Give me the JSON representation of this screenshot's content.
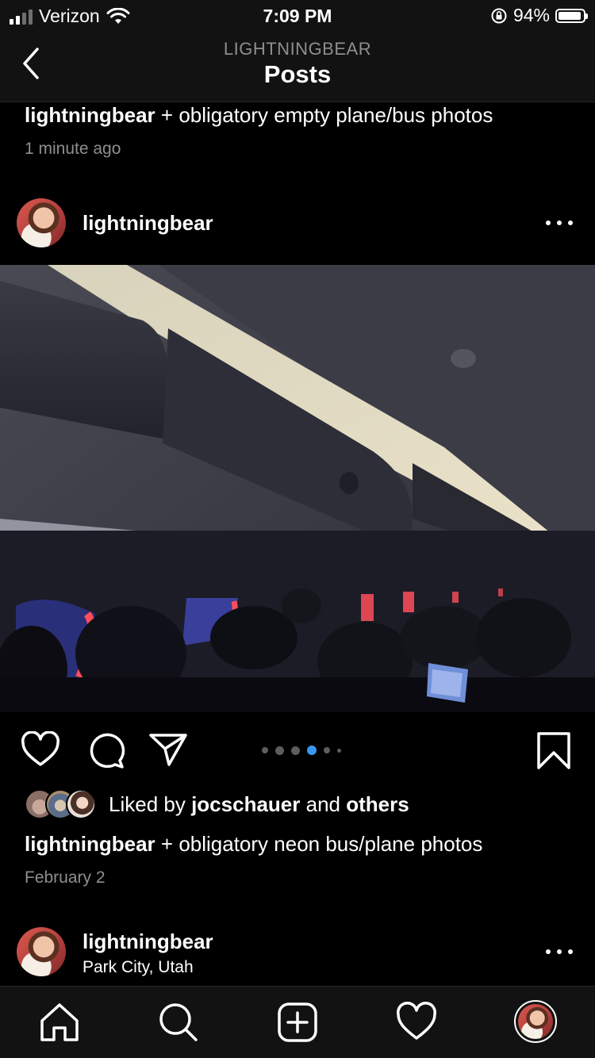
{
  "status_bar": {
    "carrier": "Verizon",
    "time": "7:09 PM",
    "battery": "94%",
    "battery_level": 0.94
  },
  "header": {
    "subtitle": "LIGHTNINGBEAR",
    "title": "Posts"
  },
  "prev_post": {
    "username": "lightningbear",
    "caption": "+ obligatory empty plane/bus photos",
    "time": "1 minute ago"
  },
  "post": {
    "username": "lightningbear",
    "photo_icon": "airplane-cabin-photo",
    "carousel_total": 6,
    "carousel_active_index": 3,
    "likes_prefix": "Liked by",
    "liked_by": "jocschauer",
    "likes_and": "and",
    "likes_others": "others",
    "caption_username": "lightningbear",
    "caption": "+ obligatory neon bus/plane photos",
    "date": "February 2"
  },
  "next_post": {
    "username": "lightningbear",
    "location": "Park City, Utah"
  },
  "tab_bar": {
    "items": [
      "home-icon",
      "search-icon",
      "new-post-icon",
      "activity-heart-icon",
      "profile-avatar"
    ]
  },
  "colors": {
    "accent_blue": "#3897f0",
    "muted_text": "#8e8e8e",
    "bar_bg": "#121212"
  }
}
